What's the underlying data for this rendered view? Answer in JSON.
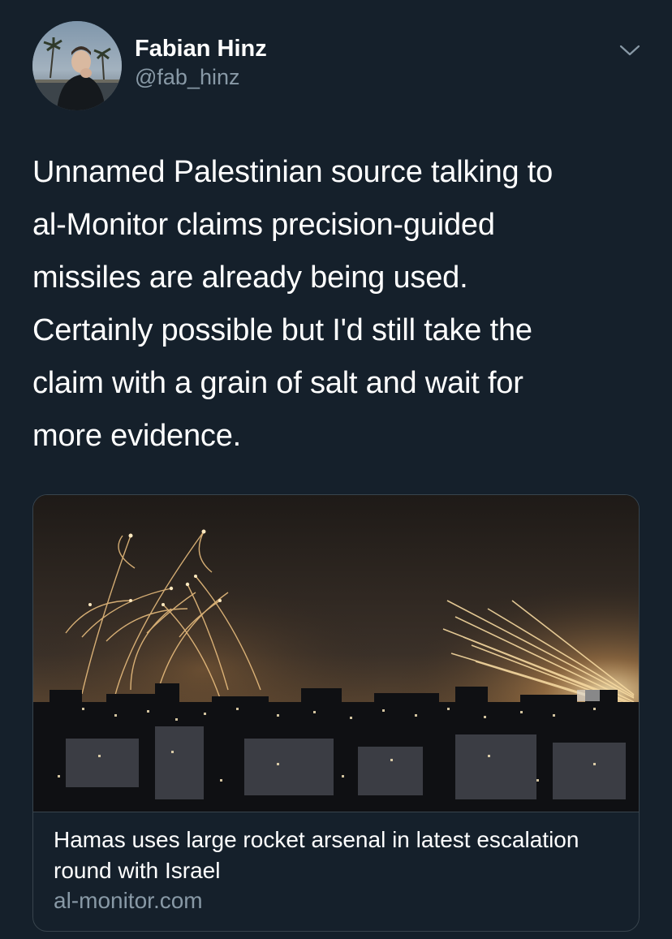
{
  "author": {
    "display_name": "Fabian Hinz",
    "handle": "@fab_hinz"
  },
  "tweet": {
    "text": "Unnamed Palestinian source talking to\nal-Monitor claims precision-guided\nmissiles are already being used.\nCertainly possible but I'd still take the\nclaim with a grain of salt and wait for\nmore evidence."
  },
  "link_card": {
    "title": "Hamas uses large rocket arsenal in latest escalation round with Israel",
    "domain": "al-monitor.com"
  },
  "icons": {
    "more": "chevron-down-icon"
  },
  "colors": {
    "background": "#15202b",
    "secondary_text": "#8899a6",
    "border": "#38444d"
  }
}
